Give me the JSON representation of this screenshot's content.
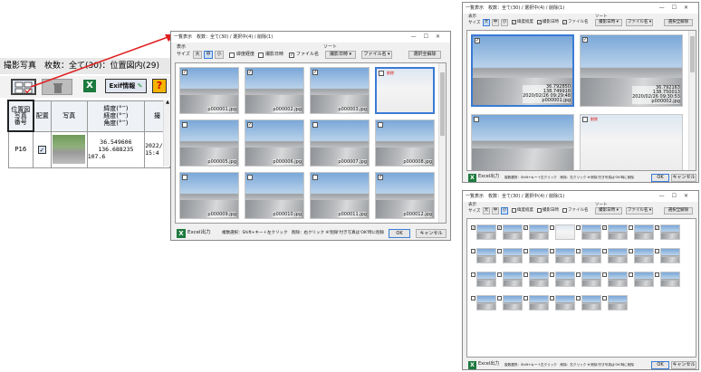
{
  "main_panel": {
    "title": "撮影写真　枚数：全て(30)：位置図内(29)",
    "toolbar": {
      "exif_label": "Exif情報",
      "help_label": "?"
    },
    "table": {
      "headers": {
        "pos": "位置図\n写真\n番号",
        "place": "配置",
        "photo": "写真",
        "coords": "緯度(°′″)\n経度(°′″)\n角度(°′″)",
        "date": "撮"
      },
      "row": {
        "pos": "P16",
        "checked": "✓",
        "lat": "36.549606",
        "lon": "136.688235",
        "angle": "107.6",
        "date": "2022/(",
        "time": "15:4"
      }
    }
  },
  "dialog_main": {
    "title": "一覧表示　枚数：全て(30) / 選択中(4) / 削除(1)",
    "display_label": "表示",
    "size_label": "サイズ",
    "size_options": [
      "大",
      "中",
      "小"
    ],
    "check_latlon": "緯度経度",
    "check_datetime": "撮影日時",
    "check_filename": "ファイル名",
    "sort_label": "ソート",
    "sort_datetime": "撮影日時 ▾",
    "sort_filename": "ファイル名 ▾",
    "clear_selection": "選択全解除",
    "excel_label": "Excel出力",
    "status_text": "複数選択：Shift+キー＋左クリック　削除：右クリック ※'削除'付き写真は'OK'時に削除",
    "ok": "OK",
    "cancel": "キャンセル",
    "deleted_tag": "削除",
    "thumbnails": [
      {
        "name": "p000001.jpg",
        "checked": "✓"
      },
      {
        "name": "p000002.jpg",
        "checked": "✓"
      },
      {
        "name": "p000003.jpg",
        "checked": "✓"
      },
      {
        "name": "",
        "checked": "",
        "deleted": true
      },
      {
        "name": "p000005.jpg",
        "checked": ""
      },
      {
        "name": "p000006.jpg",
        "checked": "✓"
      },
      {
        "name": "p000007.jpg",
        "checked": ""
      },
      {
        "name": "p000008.jpg",
        "checked": ""
      },
      {
        "name": "p000009.jpg",
        "checked": ""
      },
      {
        "name": "p000010.jpg",
        "checked": ""
      },
      {
        "name": "p000011.jpg",
        "checked": ""
      },
      {
        "name": "p000012.jpg",
        "checked": "✓"
      }
    ]
  },
  "dialog_large": {
    "title": "一覧表示　枚数：全て(30) / 選択中(4) / 削除(1)",
    "display_label": "表示",
    "size_label": "サイズ",
    "size_options": [
      "大",
      "中",
      "小"
    ],
    "check_latlon": "緯度経度",
    "check_datetime": "撮影日時",
    "check_filename": "ファイル名",
    "sort_label": "ソート",
    "sort_datetime": "撮影日時 ▾",
    "sort_filename": "ファイル名 ▾",
    "clear_selection": "選択全解除",
    "photo1": {
      "lat": "36.792850",
      "lon": "138.749918",
      "date": "2020/02/26 09:29:48",
      "name": "p000001.jpg"
    },
    "photo2": {
      "lat": "36.792163",
      "lon": "138.750013",
      "date": "2020/02/26 09:30:53",
      "name": "p000002.jpg"
    },
    "deleted_tag": "削除",
    "excel_label": "Excel出力",
    "status_text": "複数選択：Shift+キー＋左クリック　削除：右クリック ※'削除'付き写真は'OK'時に削除",
    "ok": "OK",
    "cancel": "キャンセル"
  },
  "dialog_small": {
    "title": "一覧表示　枚数：全て(30) / 選択中(4) / 削除(1)",
    "display_label": "表示",
    "size_label": "サイズ",
    "size_options": [
      "大",
      "中",
      "小"
    ],
    "check_latlon": "緯度経度",
    "check_datetime": "撮影日時",
    "check_filename": "ファイル名",
    "sort_label": "ソート",
    "sort_datetime": "撮影日時 ▾",
    "sort_filename": "ファイル名 ▾",
    "clear_selection": "選択全解除",
    "excel_label": "Excel出力",
    "status_text": "複数選択：Shift+キー＋左クリック　削除：右クリック ※'削除'付き写真は'OK'時に削除",
    "ok": "OK",
    "cancel": "キャンセル"
  },
  "colors": {
    "accent": "#3a7bd5",
    "excel": "#1d7a3e",
    "arrow": "#e02020",
    "delete": "#dd0000"
  }
}
